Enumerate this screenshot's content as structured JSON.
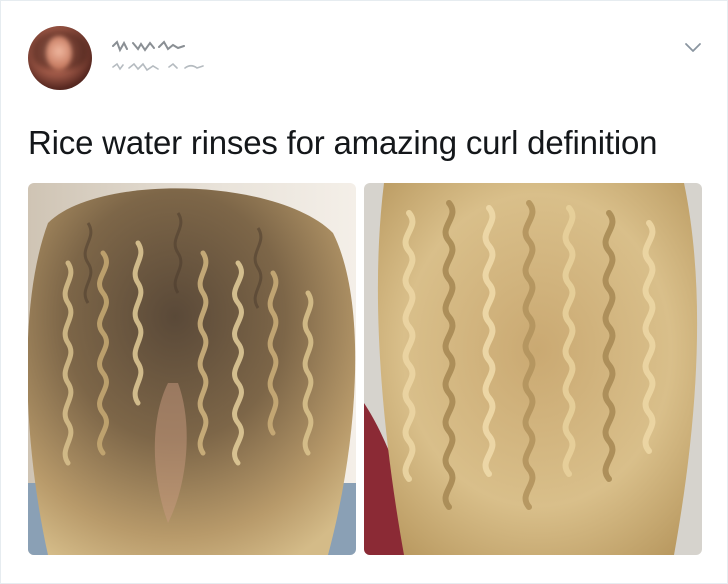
{
  "tweet": {
    "text": "Rice water rinses for amazing curl definition",
    "author": {
      "avatar_icon": "user-avatar"
    },
    "menu_icon": "chevron-down-icon",
    "photos": [
      {
        "name": "before-photo",
        "colors": {
          "hair_dark": "#6b5a45",
          "hair_light": "#d8bf8c",
          "background": "#e8e2d8",
          "shirt": "#8aa0b5"
        }
      },
      {
        "name": "after-photo",
        "colors": {
          "hair_dark": "#9b8258",
          "hair_light": "#e6cf9a",
          "background": "#d9d6d0",
          "sweater": "#8b2a35"
        }
      }
    ]
  }
}
